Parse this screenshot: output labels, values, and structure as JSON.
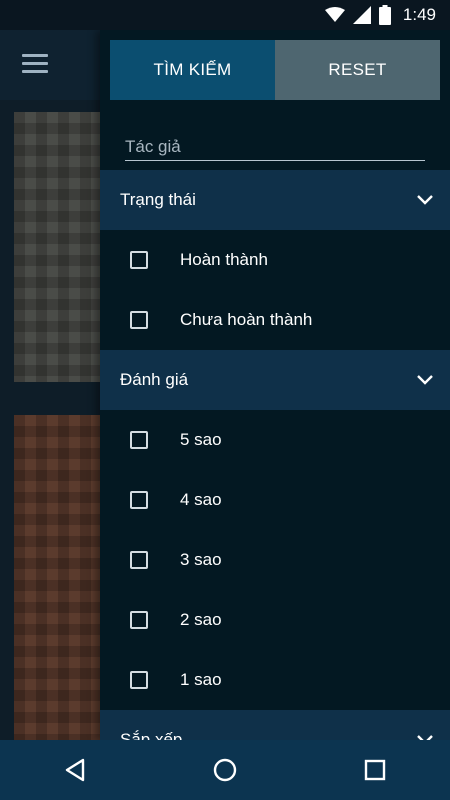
{
  "status_bar": {
    "time": "1:49",
    "icons": [
      "wifi-icon",
      "signal-icon",
      "battery-icon"
    ]
  },
  "background_app": {
    "menu_icon": "hamburger-menu-icon"
  },
  "drawer": {
    "search_button": "TÌM KIẾM",
    "reset_button": "RESET",
    "author_placeholder": "Tác giả",
    "sections": [
      {
        "title": "Trạng thái",
        "options": [
          "Hoàn thành",
          "Chưa hoàn thành"
        ]
      },
      {
        "title": "Đánh giá",
        "options": [
          "5 sao",
          "4 sao",
          "3 sao",
          "2 sao",
          "1 sao"
        ]
      },
      {
        "title": "Sắp xếp",
        "options": []
      }
    ]
  },
  "nav_bar": {
    "buttons": [
      "back-icon",
      "home-icon",
      "recents-icon"
    ]
  },
  "colors": {
    "drawer_bg": "#031822",
    "section_header_bg": "#0f3049",
    "search_button_bg": "#0b4e70",
    "reset_button_bg": "#4e6670",
    "nav_bar_bg": "#0c3450"
  }
}
